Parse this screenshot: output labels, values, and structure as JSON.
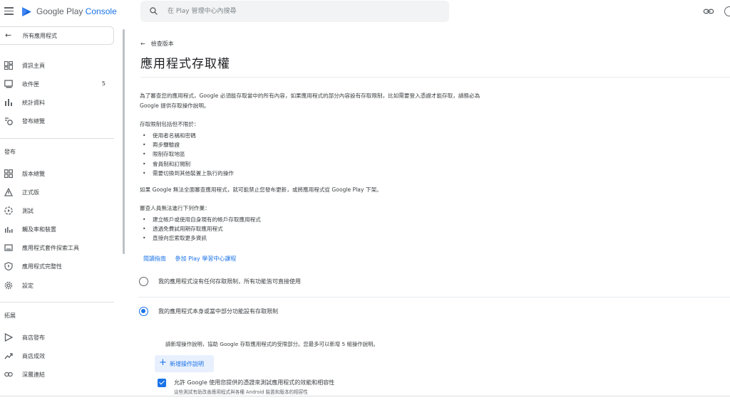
{
  "app": {
    "brand_prefix": "Google Play",
    "brand_suffix": "Console",
    "search_placeholder": "在 Play 管理中心內搜尋"
  },
  "sidebar": {
    "back_label": "所有應用程式",
    "items": [
      {
        "label": "資訊主頁",
        "icon": "dashboard-icon"
      },
      {
        "label": "收件匣",
        "icon": "inbox-icon",
        "count": "5"
      },
      {
        "label": "統計資料",
        "icon": "bar-chart-icon"
      },
      {
        "label": "發布總覽",
        "icon": "publishing-overview-icon"
      }
    ],
    "section_release": "發布",
    "release_items": [
      {
        "label": "版本總覽",
        "icon": "releases-overview-icon"
      },
      {
        "label": "正式版",
        "icon": "production-icon"
      },
      {
        "label": "測試",
        "icon": "testing-icon"
      },
      {
        "label": "觸及率和裝置",
        "icon": "reach-devices-icon"
      },
      {
        "label": "應用程式套件探索工具",
        "icon": "bundle-explorer-icon"
      },
      {
        "label": "應用程式完整性",
        "icon": "shield-icon"
      },
      {
        "label": "設定",
        "icon": "gear-icon"
      }
    ],
    "section_grow": "拓展",
    "grow_items": [
      {
        "label": "商店發布",
        "icon": "store-presence-icon"
      },
      {
        "label": "商店成效",
        "icon": "trending-icon"
      },
      {
        "label": "深層連結",
        "icon": "link-icon"
      }
    ]
  },
  "main": {
    "breadcrumb": "檢查版本",
    "title": "應用程式存取權",
    "intro_line1": "為了審查您的應用程式，Google 必須能存取當中的所有內容，如果應用程式的部分內容設有存取限制，比如需要登入憑證才能存取，請務必為",
    "intro_line2": "Google 提供存取操作說明。",
    "restrictions_heading": "存取限制包括但不限於：",
    "restrictions": [
      "使用者名稱和密碼",
      "兩步驟驗證",
      "限制存取地區",
      "會員制和訂閱制",
      "需要切換到其他裝置上執行的操作"
    ],
    "warning": "如果 Google 無法全面審查應用程式，就可能禁止您發布更新，或將應用程式從 Google Play 下架。",
    "reviewer_heading": "審查人員無法進行下列作業：",
    "reviewer_items": [
      "建立帳戶或使用自身現有的帳戶存取應用程式",
      "透過免費試用期存取應用程式",
      "直接向您索取更多資訊"
    ],
    "link_guide": "閱讀指南",
    "link_course": "參加 Play 學習中心課程",
    "option_none": "我的應用程式沒有任何存取限制，所有功能皆可直接使用",
    "option_restricted": "我的應用程式本身或當中部分功能設有存取限制",
    "instructions_hint": "請新增操作說明，協助 Google 存取應用程式的受限部分。您最多可以新增 5 組操作說明。",
    "add_button": "新增操作說明",
    "checkbox_label": "允許 Google 使用您提供的憑證來測試應用程式的效能和相容性",
    "checkbox_sub": "這些測試有助改善應用程式與各種 Android 裝置和版本的相容性"
  },
  "colors": {
    "accent": "#1a73e8",
    "text": "#3c4043"
  }
}
